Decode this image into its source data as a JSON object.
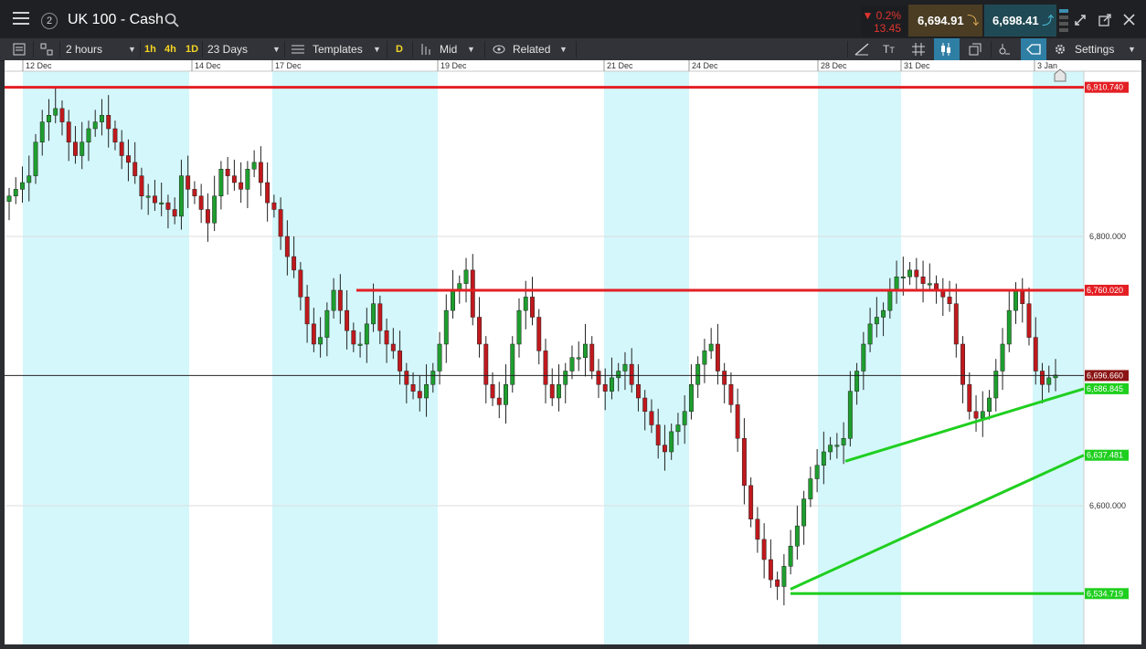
{
  "header": {
    "title": "UK 100 - Cash",
    "badge": "2",
    "change_pct": "▼ 0.2%",
    "change_pts": "13.45",
    "sell_price": "6,694.91",
    "buy_price": "6,698.41"
  },
  "toolbar": {
    "interval": "2 hours",
    "tf_1h": "1h",
    "tf_4h": "4h",
    "tf_1d": "1D",
    "range": "23 Days",
    "templates": "Templates",
    "d_label": "D",
    "price_type": "Mid",
    "related": "Related",
    "settings": "Settings"
  },
  "colors": {
    "up": "#1e9e2e",
    "down": "#c0191d",
    "band": "#d4f7fb",
    "resistance": "#e31f24",
    "support": "#1fcf1f"
  },
  "chart_data": {
    "type": "candlestick",
    "timeframe": "2 hours",
    "ylim": [
      6500,
      6930
    ],
    "y_ticks": [
      "6,800.000",
      "6,600.000"
    ],
    "x_labels": [
      "12 Dec",
      "14 Dec",
      "17 Dec",
      "19 Dec",
      "21 Dec",
      "24 Dec",
      "28 Dec",
      "31 Dec",
      "3 Jan"
    ],
    "current_price": 6696.66,
    "current_price_label": "6,696.660",
    "price_labels": [
      {
        "label": "6,910.740",
        "kind": "resistance"
      },
      {
        "label": "6,760.020",
        "kind": "resistance"
      },
      {
        "label": "6,696.660",
        "kind": "current"
      },
      {
        "label": "6,686.845",
        "kind": "support"
      },
      {
        "label": "6,637.481",
        "kind": "support"
      },
      {
        "label": "6,534.719",
        "kind": "support"
      }
    ],
    "horizontal_lines": [
      6910.74,
      6760.02,
      6534.719
    ],
    "trendlines": [
      {
        "from": [
          6633,
          1
        ],
        "to": [
          6686.845,
          3
        ],
        "note": "rising support"
      },
      {
        "from": [
          6534.719,
          0
        ],
        "to": [
          6637.481,
          3
        ],
        "note": "rising support"
      }
    ],
    "closes": [
      6830,
      6835,
      6840,
      6845,
      6870,
      6885,
      6890,
      6895,
      6885,
      6870,
      6860,
      6870,
      6880,
      6885,
      6890,
      6880,
      6870,
      6860,
      6855,
      6845,
      6830,
      6830,
      6825,
      6825,
      6820,
      6815,
      6845,
      6835,
      6830,
      6820,
      6810,
      6830,
      6850,
      6845,
      6840,
      6835,
      6850,
      6855,
      6840,
      6825,
      6820,
      6800,
      6785,
      6775,
      6755,
      6735,
      6720,
      6725,
      6745,
      6760,
      6745,
      6730,
      6720,
      6720,
      6735,
      6750,
      6730,
      6720,
      6715,
      6700,
      6690,
      6685,
      6680,
      6690,
      6700,
      6720,
      6745,
      6760,
      6765,
      6775,
      6740,
      6720,
      6690,
      6680,
      6675,
      6690,
      6720,
      6745,
      6755,
      6740,
      6715,
      6690,
      6680,
      6690,
      6700,
      6710,
      6710,
      6720,
      6700,
      6690,
      6685,
      6695,
      6700,
      6705,
      6690,
      6680,
      6670,
      6660,
      6645,
      6640,
      6655,
      6660,
      6670,
      6690,
      6705,
      6715,
      6720,
      6700,
      6690,
      6675,
      6650,
      6615,
      6590,
      6575,
      6560,
      6545,
      6540,
      6555,
      6570,
      6585,
      6605,
      6620,
      6630,
      6640,
      6645,
      6645,
      6650,
      6685,
      6700,
      6720,
      6735,
      6740,
      6745,
      6760,
      6770,
      6770,
      6775,
      6770,
      6765,
      6765,
      6760,
      6755,
      6750,
      6720,
      6690,
      6670,
      6665,
      6670,
      6680,
      6700,
      6720,
      6745,
      6760,
      6750,
      6725,
      6700,
      6690,
      6695,
      6697
    ],
    "annotations": [
      "horizontal resistance lines",
      "rising green trendlines",
      "home marker"
    ]
  }
}
